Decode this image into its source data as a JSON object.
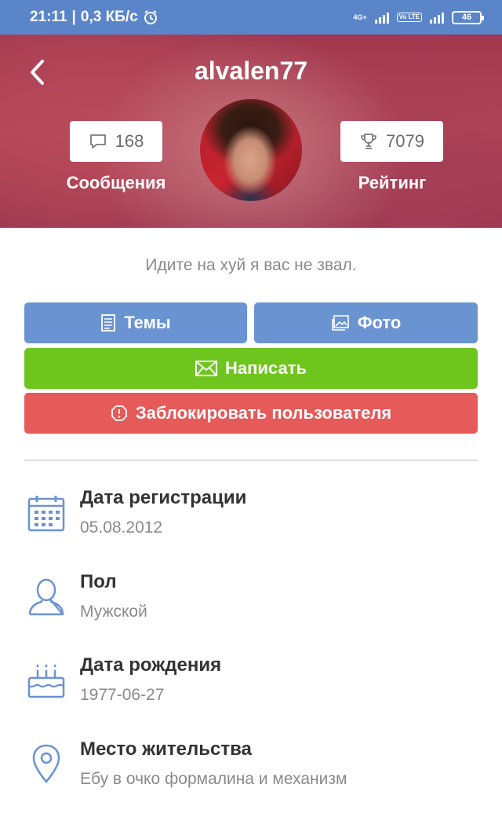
{
  "status_bar": {
    "time": "21:11",
    "speed": "0,3 КБ/с",
    "network_label": "4G+",
    "volte_label": "Vo LTE",
    "battery": "46"
  },
  "profile": {
    "username": "alvalen77",
    "messages_count": "168",
    "messages_label": "Сообщения",
    "rating_value": "7079",
    "rating_label": "Рейтинг",
    "status_text": "Идите на хуй я вас не звал."
  },
  "actions": {
    "topics_label": "Темы",
    "photo_label": "Фото",
    "write_label": "Написать",
    "block_label": "Заблокировать пользователя"
  },
  "info": [
    {
      "title": "Дата регистрации",
      "value": "05.08.2012",
      "icon": "calendar-icon"
    },
    {
      "title": "Пол",
      "value": "Мужской",
      "icon": "person-icon"
    },
    {
      "title": "Дата рождения",
      "value": "1977-06-27",
      "icon": "birthday-cake-icon"
    },
    {
      "title": "Место жительства",
      "value": "Ебу в очко формалина и механизм",
      "icon": "location-pin-icon"
    }
  ],
  "colors": {
    "status_bar": "#5b85c9",
    "topics_button": "#6a93d2",
    "write_button": "#6ec51d",
    "block_button": "#e65a5a",
    "icon_blue": "#6a93d2"
  }
}
